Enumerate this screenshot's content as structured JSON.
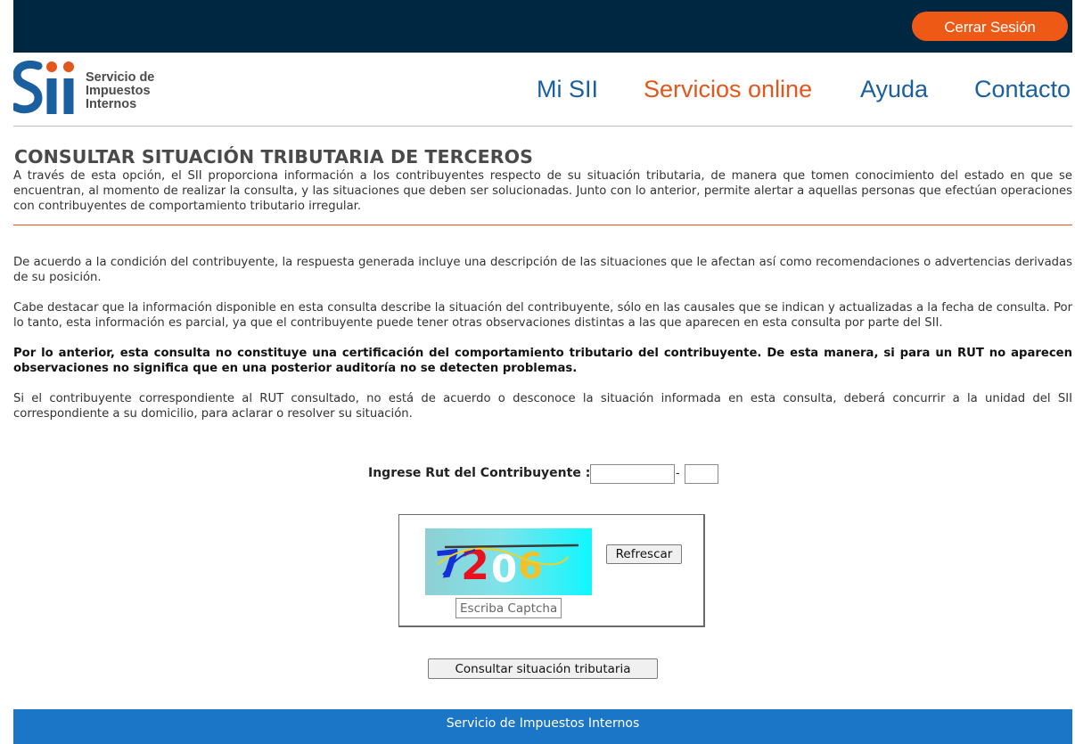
{
  "header": {
    "logout_label": "Cerrar Sesión"
  },
  "logo": {
    "line1": "Servicio de",
    "line2": "Impuestos",
    "line3": "Internos"
  },
  "nav": {
    "items": [
      {
        "label": "Mi SII",
        "active": false
      },
      {
        "label": "Servicios online",
        "active": true
      },
      {
        "label": "Ayuda",
        "active": false
      },
      {
        "label": "Contacto",
        "active": false
      }
    ]
  },
  "page": {
    "title": "CONSULTAR SITUACIÓN TRIBUTARIA DE TERCEROS",
    "intro": "A través de esta opción, el SII proporciona información a los contribuyentes respecto de su situación tributaria, de manera que tomen conocimiento del estado en que se encuentran, al momento de realizar la consulta, y las situaciones que deben ser solucionadas. Junto con lo anterior, permite alertar a aquellas personas que efectúan operaciones con contribuyentes de comportamiento tributario irregular.",
    "para1": "De acuerdo a la condición del contribuyente, la respuesta generada incluye una descripción de las situaciones que le afectan así como recomendaciones o advertencias derivadas de su posición.",
    "para2": "Cabe destacar que la información disponible en esta consulta describe la situación del contribuyente, sólo en las causales que se indican y actualizadas a la fecha de consulta. Por lo tanto, esta información es parcial, ya que el contribuyente puede tener otras observaciones distintas a las que aparecen en esta consulta por parte del SII.",
    "para3_bold": "Por lo anterior, esta consulta no constituye una certificación del comportamiento tributario del contribuyente. De esta manera, si para un RUT no aparecen observaciones no significa que en una posterior auditoría no se detecten problemas.",
    "para4": "Si el contribuyente correspondiente al RUT consultado, no está de acuerdo o desconoce la situación informada en esta consulta, deberá concurrir a la unidad del SII correspondiente a su domicilio, para aclarar o resolver su situación."
  },
  "form": {
    "rut_label": "Ingrese Rut del Contribuyente :",
    "rut_value": "",
    "dash": "-",
    "dv_value": "",
    "captcha_text": "7206",
    "refresh_label": "Refrescar",
    "captcha_placeholder": "Escriba Captcha",
    "submit_label": "Consultar situación tributaria"
  },
  "footer": {
    "text": "Servicio de Impuestos Internos"
  },
  "colors": {
    "topbar": "#002742",
    "accent_orange": "#ee5a16",
    "nav_blue": "#1a5fa0",
    "footer_blue": "#1c76c8"
  }
}
